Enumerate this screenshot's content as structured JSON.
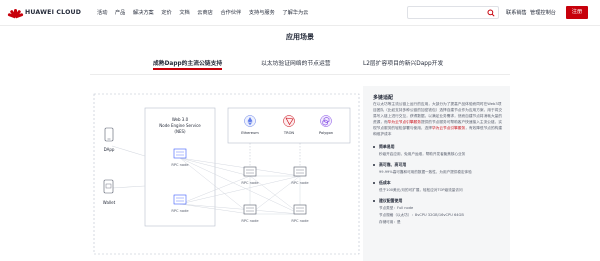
{
  "header": {
    "brand": "HUAWEI CLOUD",
    "nav": [
      "活动",
      "产品",
      "解决方案",
      "定价",
      "文档",
      "云商店",
      "合作伙伴",
      "支持与服务",
      "了解华为云"
    ],
    "search_placeholder": "",
    "links": [
      "联系销售",
      "管理控制台",
      "备案"
    ],
    "register": "注册"
  },
  "section": {
    "title": "应用场景",
    "tabs": [
      {
        "label": "成熟Dapp的主流公链支持",
        "active": true
      },
      {
        "label": "以太坊验证网络的节点运营",
        "active": false
      },
      {
        "label": "L2层扩容项目的新兴Dapp开发",
        "active": false
      }
    ]
  },
  "diagram": {
    "clients": [
      {
        "label": "DApp",
        "icon": "phone-icon"
      },
      {
        "label": "Wallet",
        "icon": "wallet-phone-icon"
      }
    ],
    "service_title_line1": "Web 3.0",
    "service_title_line2": "Node Engine Service",
    "service_title_line3": "(NES)",
    "node_label": "RPC node",
    "chains": [
      {
        "label": "Ethereum",
        "color": "#627eea"
      },
      {
        "label": "TRON",
        "color": "#c7000b"
      },
      {
        "label": "Polygon",
        "color": "#8247e5"
      }
    ],
    "colors": {
      "node": "#3d5afe",
      "dash": "#b8bfcc",
      "line": "#d5d9e0"
    }
  },
  "info": {
    "title": "多链适配",
    "description": "在以太坊等主流公链上运行的应用，大部分为了提高产品体验而同时在Web3项目团队（比如支持多种公链的加密钱包）选择自建节点作为应用方案，用于将交易写入链上进行交互，获得数据，以满足业务需求，然而自建节点将消耗大量的资源，而华为云节点引擎服务提供的节点服务可帮助客户快速接入主流公链，实现节点服务的轻松部署与使用，选择华为云节点引擎服务，有效降低节点的构建和维护成本",
    "highlight": "华为云节点引擎服务",
    "features": [
      {
        "title": "简单易用",
        "desc": "秒级开启应用，免用户运维，帮助开发者聚焦核心业务"
      },
      {
        "title": "高可靠、高可用",
        "desc": "99.99%高可靠和可用的数据一致性，为用户提供稳定体验"
      },
      {
        "title": "低成本",
        "desc": "低于100美元/月的可扩展，轻松应对TOP级流量访问"
      },
      {
        "title": "建议配置使用",
        "lines": [
          "节点类型：Full node",
          "节点规格（以太坊）：8vCPU 32GB/16vCPU 64GB",
          "存储可用：是"
        ]
      }
    ]
  }
}
